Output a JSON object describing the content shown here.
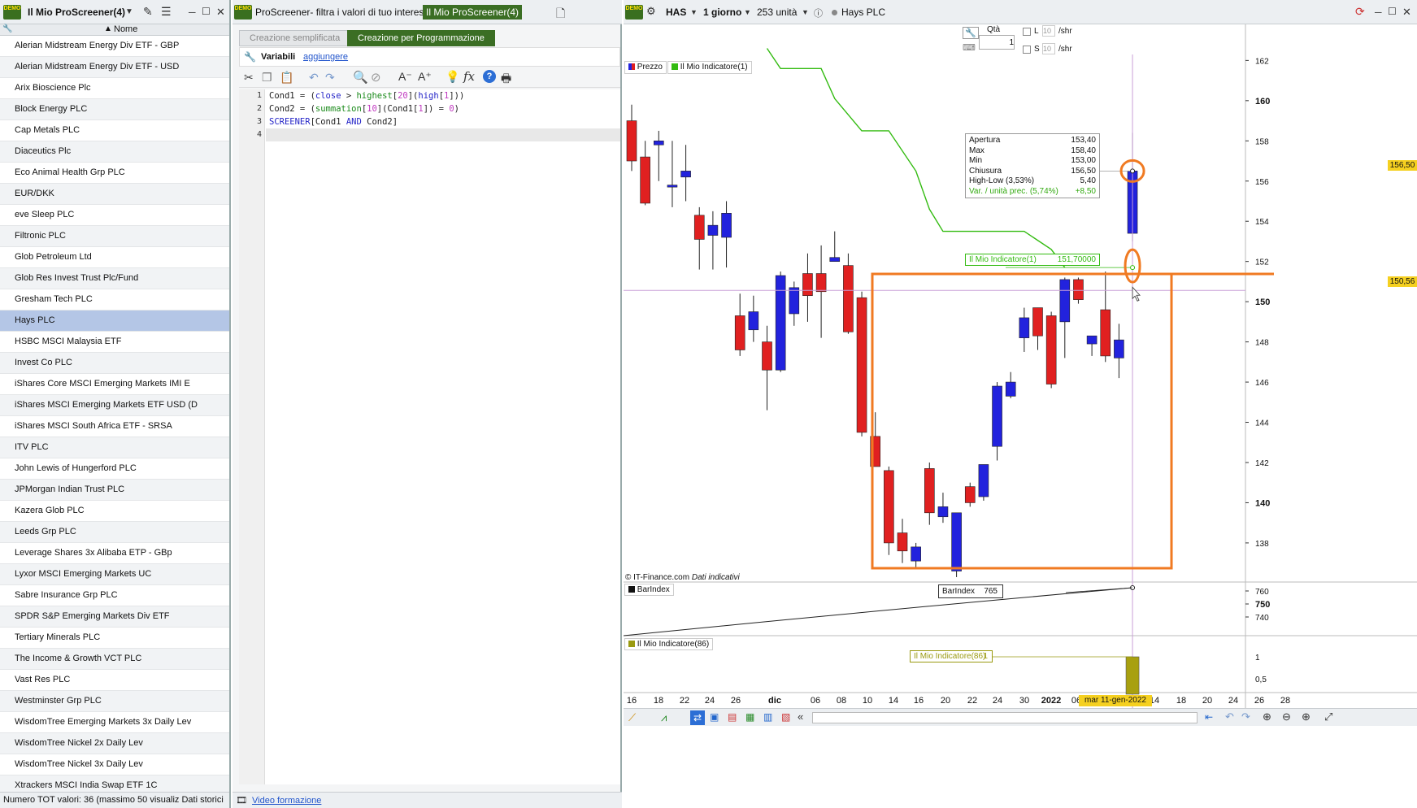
{
  "left_panel": {
    "title": "Il Mio ProScreener(4)",
    "column_header": "Nome",
    "rows": [
      "Alerian Midstream Energy Div ETF - GBP",
      "Alerian Midstream Energy Div ETF - USD",
      "Arix Bioscience Plc",
      "Block Energy PLC",
      "Cap Metals PLC",
      "Diaceutics Plc",
      "Eco Animal Health Grp PLC",
      "EUR/DKK",
      "eve Sleep PLC",
      "Filtronic PLC",
      "Glob Petroleum Ltd",
      "Glob Res Invest Trust Plc/Fund",
      "Gresham Tech PLC",
      "Hays PLC",
      "HSBC MSCI Malaysia ETF",
      "Invest Co PLC",
      "iShares Core MSCI Emerging Markets IMI E",
      "iShares MSCI Emerging Markets ETF USD (D",
      "iShares MSCI South Africa ETF - SRSA",
      "ITV PLC",
      "John Lewis of Hungerford PLC",
      "JPMorgan Indian Trust PLC",
      "Kazera Glob PLC",
      "Leeds Grp PLC",
      "Leverage Shares 3x Alibaba ETP - GBp",
      "Lyxor MSCI Emerging Markets UC",
      "Sabre Insurance Grp PLC",
      "SPDR S&P Emerging Markets Div ETF",
      "Tertiary Minerals PLC",
      "The Income & Growth VCT PLC",
      "Vast Res PLC",
      "Westminster Grp PLC",
      "WisdomTree Emerging Markets 3x Daily Lev",
      "WisdomTree Nickel 2x Daily Lev",
      "WisdomTree Nickel 3x Daily Lev",
      "Xtrackers MSCI India Swap ETF 1C"
    ],
    "selected_row": "Hays PLC",
    "footer": "Numero TOT valori: 36 (massimo 50 visualiz  Dati storici"
  },
  "mid_panel": {
    "title": "ProScreener- filtra i valori di tuo interesse",
    "title_tag": "Il Mio ProScreener(4)",
    "tab_simple": "Creazione semplificata",
    "tab_program": "Creazione per Programmazione",
    "variables_label": "Variabili",
    "variables_link": "aggiungere",
    "code_lines": [
      "1",
      "2",
      "3",
      "4"
    ],
    "footer_link": "Video formazione"
  },
  "chart_panel": {
    "ticker": "HAS",
    "timeframe": "1 giorno",
    "units": "253 unità",
    "instrument": "Hays PLC",
    "qty_label": "Qtà",
    "qty_value": "1",
    "limit_label": "L",
    "stop_label": "S",
    "limit_value": "10",
    "stop_value": "10",
    "per_share": "/shr",
    "legend_price": "Prezzo",
    "legend_indicator": "Il Mio Indicatore(1)",
    "copyright": "© IT-Finance.com",
    "copyright_note": "Dati indicativi",
    "barindex_label": "BarIndex",
    "barindex_value": "765",
    "indicator86_label": "Il Mio Indicatore(86)",
    "indicator86_value": "1",
    "indicator1_value": "151,70000",
    "price_badge": "156,50",
    "cursor_badge": "150,56",
    "cursor_date": "mar 11-gen-2022",
    "tooltip": [
      {
        "k": "Apertura",
        "v": "153,40"
      },
      {
        "k": "Max",
        "v": "158,40"
      },
      {
        "k": "Min",
        "v": "153,00"
      },
      {
        "k": "Chiusura",
        "v": "156,50"
      },
      {
        "k": "High-Low (3,53%)",
        "v": "5,40"
      },
      {
        "k": "Var. / unità prec. (5,74%)",
        "v": "+8,50"
      }
    ],
    "colors": {
      "up": "#2222dd",
      "down": "#e02020",
      "indicator": "#33bb11",
      "highlight": "#f07a22"
    }
  },
  "chart_data": {
    "type": "candlestick",
    "x_tick_labels": [
      "16",
      "18",
      "22",
      "24",
      "26",
      "dic",
      "06",
      "08",
      "10",
      "14",
      "16",
      "20",
      "22",
      "24",
      "30",
      "2022",
      "06",
      "mar 11-gen-2022",
      "14",
      "18",
      "20",
      "24",
      "26",
      "28"
    ],
    "y_ticks": [
      138,
      140,
      142,
      144,
      146,
      148,
      150,
      152,
      154,
      156,
      158,
      160,
      162
    ],
    "y_minor_labels": [
      "138",
      "140",
      "142",
      "144",
      "146",
      "148",
      "150",
      "152",
      "154",
      "156",
      "158",
      "160",
      "162"
    ],
    "barindex_ticks": [
      "740",
      "750",
      "760"
    ],
    "indicator86_ticks": [
      "0,5",
      "1"
    ],
    "ylim": [
      136.5,
      162.5
    ],
    "candles": [
      {
        "o": 159,
        "h": 159.8,
        "l": 156.5,
        "c": 157
      },
      {
        "o": 157.2,
        "h": 158,
        "l": 154.8,
        "c": 154.9
      },
      {
        "o": 157.8,
        "h": 158.5,
        "l": 156,
        "c": 158
      },
      {
        "o": 155.7,
        "h": 158,
        "l": 154.7,
        "c": 155.8
      },
      {
        "o": 156.2,
        "h": 157.8,
        "l": 155,
        "c": 156.5
      },
      {
        "o": 154.3,
        "h": 154.7,
        "l": 151.6,
        "c": 153.1
      },
      {
        "o": 153.3,
        "h": 154.5,
        "l": 151.6,
        "c": 153.8
      },
      {
        "o": 153.2,
        "h": 155,
        "l": 151.7,
        "c": 154.4
      },
      {
        "o": 149.3,
        "h": 150.4,
        "l": 147.3,
        "c": 147.6
      },
      {
        "o": 148.6,
        "h": 150.3,
        "l": 148,
        "c": 149.5
      },
      {
        "o": 148,
        "h": 148.8,
        "l": 144.6,
        "c": 146.6
      },
      {
        "o": 146.6,
        "h": 151.5,
        "l": 146.5,
        "c": 151.3
      },
      {
        "o": 149.4,
        "h": 151,
        "l": 148.8,
        "c": 150.7
      },
      {
        "o": 151.4,
        "h": 152.4,
        "l": 149,
        "c": 150.3
      },
      {
        "o": 151.4,
        "h": 152.8,
        "l": 148.2,
        "c": 150.5
      },
      {
        "o": 152,
        "h": 153.5,
        "l": 152,
        "c": 152.2
      },
      {
        "o": 151.8,
        "h": 152.4,
        "l": 148.4,
        "c": 148.5
      },
      {
        "o": 150.2,
        "h": 150.5,
        "l": 143.3,
        "c": 143.5
      },
      {
        "o": 143.3,
        "h": 144.5,
        "l": 141.8,
        "c": 141.8
      },
      {
        "o": 141.6,
        "h": 141.8,
        "l": 137.4,
        "c": 138
      },
      {
        "o": 138.5,
        "h": 139.2,
        "l": 137,
        "c": 137.6
      },
      {
        "o": 137.1,
        "h": 138,
        "l": 136.8,
        "c": 137.8
      },
      {
        "o": 141.7,
        "h": 142,
        "l": 138.9,
        "c": 139.5
      },
      {
        "o": 139.3,
        "h": 140.5,
        "l": 139,
        "c": 139.8
      },
      {
        "o": 136.6,
        "h": 139.5,
        "l": 136.3,
        "c": 139.5
      },
      {
        "o": 140.8,
        "h": 141,
        "l": 139.8,
        "c": 140
      },
      {
        "o": 140.3,
        "h": 141.8,
        "l": 140.1,
        "c": 141.9
      },
      {
        "o": 142.8,
        "h": 146,
        "l": 142.1,
        "c": 145.8
      },
      {
        "o": 145.3,
        "h": 146.5,
        "l": 145.2,
        "c": 146
      },
      {
        "o": 148.2,
        "h": 149.7,
        "l": 147.5,
        "c": 149.2
      },
      {
        "o": 149.7,
        "h": 149.7,
        "l": 147.6,
        "c": 148.3
      },
      {
        "o": 149.3,
        "h": 149.5,
        "l": 145.7,
        "c": 145.9
      },
      {
        "o": 149,
        "h": 151.2,
        "l": 147.2,
        "c": 151.1
      },
      {
        "o": 151.1,
        "h": 151.2,
        "l": 149.9,
        "c": 150.1
      },
      {
        "o": 147.9,
        "h": 148,
        "l": 147.3,
        "c": 148.3
      },
      {
        "o": 149.6,
        "h": 151.5,
        "l": 147,
        "c": 147.3
      },
      {
        "o": 147.2,
        "h": 148.9,
        "l": 146.2,
        "c": 148.1
      },
      {
        "o": 153.4,
        "h": 158.4,
        "l": 153,
        "c": 156.5
      }
    ],
    "indicator_line": [
      {
        "i": 10,
        "v": 162.6
      },
      {
        "i": 11,
        "v": 161.6
      },
      {
        "i": 14,
        "v": 161.6
      },
      {
        "i": 15,
        "v": 160.1
      },
      {
        "i": 17,
        "v": 158.5
      },
      {
        "i": 19,
        "v": 158.5
      },
      {
        "i": 21,
        "v": 156.5
      },
      {
        "i": 22,
        "v": 154.6
      },
      {
        "i": 23,
        "v": 153.5
      },
      {
        "i": 29,
        "v": 153.5
      },
      {
        "i": 31,
        "v": 152.6
      },
      {
        "i": 32,
        "v": 151.7
      }
    ]
  }
}
